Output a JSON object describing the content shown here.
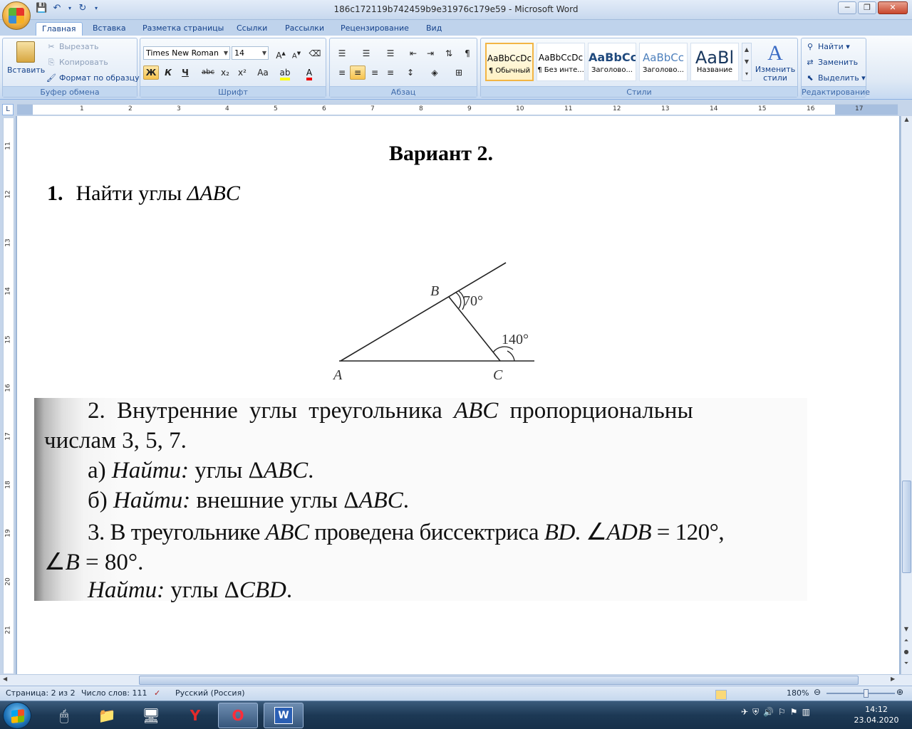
{
  "window": {
    "title": "186c172119b742459b9e31976c179e59 - Microsoft Word",
    "controls": {
      "minimize": "─",
      "maximize": "❐",
      "close": "✕"
    }
  },
  "tabs": [
    "Главная",
    "Вставка",
    "Разметка страницы",
    "Ссылки",
    "Рассылки",
    "Рецензирование",
    "Вид"
  ],
  "ribbon": {
    "clipboard": {
      "paste": "Вставить",
      "cut": "Вырезать",
      "copy": "Копировать",
      "format_painter": "Формат по образцу",
      "label": "Буфер обмена"
    },
    "font": {
      "name": "Times New Roman",
      "size": "14",
      "bold": "Ж",
      "italic": "К",
      "underline": "Ч",
      "strike": "abc",
      "sub": "x₂",
      "sup": "x²",
      "case": "Аа",
      "label": "Шрифт"
    },
    "paragraph": {
      "label": "Абзац",
      "pilcrow": "¶"
    },
    "styles": {
      "items": [
        {
          "sample": "AaBbCcDc",
          "name": "¶ Обычный"
        },
        {
          "sample": "AaBbCcDc",
          "name": "¶ Без инте..."
        },
        {
          "sample": "AaBbCc",
          "name": "Заголово..."
        },
        {
          "sample": "AaBbCc",
          "name": "Заголово..."
        },
        {
          "sample": "AaBl",
          "name": "Название"
        }
      ],
      "change": "Изменить стили",
      "label": "Стили"
    },
    "editing": {
      "find": "Найти",
      "replace": "Заменить",
      "select": "Выделить",
      "label": "Редактирование"
    }
  },
  "ruler": {
    "corner": "L",
    "h_ticks": [
      "1",
      "2",
      "3",
      "4",
      "5",
      "6",
      "7",
      "8",
      "9",
      "10",
      "11",
      "12",
      "13",
      "14",
      "15",
      "16",
      "17"
    ],
    "v_ticks": [
      "11",
      "12",
      "13",
      "14",
      "15",
      "16",
      "17",
      "18",
      "19",
      "20",
      "21"
    ]
  },
  "document": {
    "heading": "Вариант 2.",
    "task1": {
      "number": "1.",
      "text": "Найти углы",
      "math": "ΔABC"
    },
    "figure": {
      "label_a": "A",
      "label_b": "B",
      "label_c": "C",
      "angle_b": "70°",
      "angle_c": "140°"
    },
    "scan": {
      "line1": {
        "prefix": "2. Внутренние углы треугольника ",
        "abc": "ABC",
        "suffix": " пропорциональны"
      },
      "line2": "числам 3, 5, 7.",
      "line3": {
        "prefix": "а) ",
        "find": "Найти:",
        "text": " углы Δ",
        "abc": "ABC",
        "end": "."
      },
      "line4": {
        "prefix": "б) ",
        "find": "Найти:",
        "text": " внешние углы Δ",
        "abc": "ABC",
        "end": "."
      },
      "line5": {
        "prefix": "3. В треугольнике ",
        "abc": "ABC",
        "mid": " проведена биссектриса ",
        "bd": "BD",
        "mid2": ". ∠",
        "adb": "ADB",
        "end": " = 120°,"
      },
      "line6": {
        "angle": "∠",
        "b": "B",
        "end": " = 80°."
      },
      "line7": {
        "find": "Найти:",
        "text": " углы Δ",
        "cbd": "CBD",
        "end": "."
      }
    }
  },
  "status": {
    "page": "Страница: 2 из 2",
    "words": "Число слов: 111",
    "language": "Русский (Россия)",
    "zoom": "180%"
  },
  "taskbar": {
    "time": "14:12",
    "date": "23.04.2020"
  }
}
